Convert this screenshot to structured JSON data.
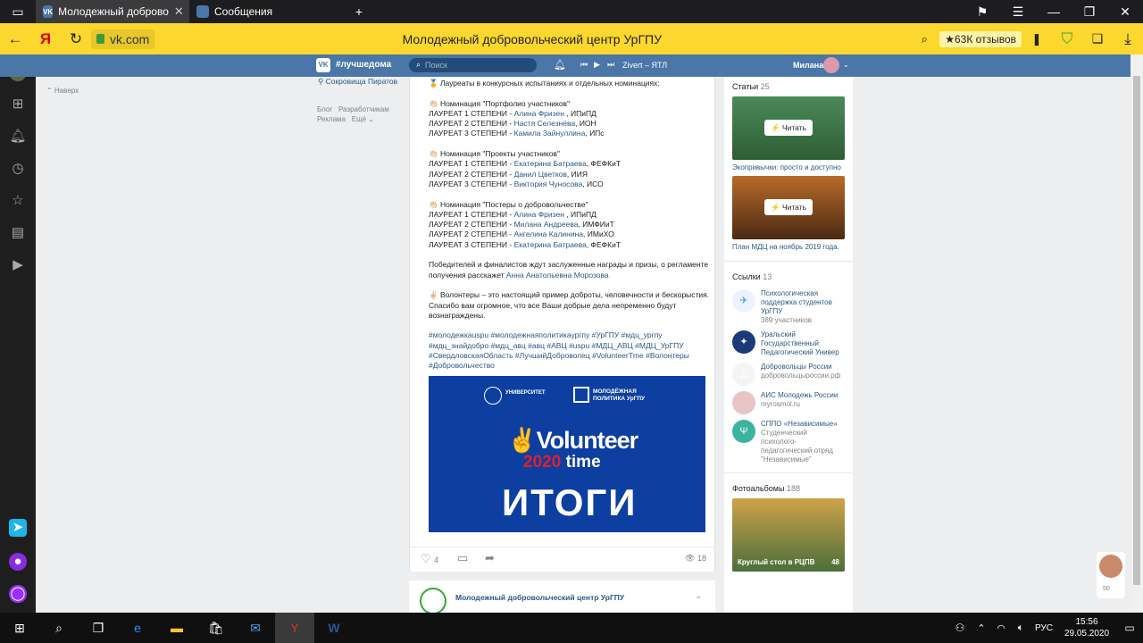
{
  "browser": {
    "tab1": "Молодежный доброво",
    "tab2": "Сообщения",
    "domain": "vk.com",
    "title": "Молодежный добровольческий центр УрГПУ",
    "reviews": "★63К отзывов"
  },
  "vk": {
    "hashtag": "#лучшедома",
    "search_placeholder": "Поиск",
    "track": "Zivert – ЯТЛ",
    "user": "Милана"
  },
  "left": {
    "up": "Наверх",
    "link1": "Сокровища Пиратов",
    "f1": "Блог",
    "f2": "Разработчикам",
    "f3": "Реклама",
    "f4": "Ещё ⌄"
  },
  "post": {
    "intro": "🏅 Лауреаты в конкурсных испытаниях и отдельных номинациях:",
    "n1": "👏🏻 Номинация \"Портфолио участников\"",
    "n1l": [
      [
        "ЛАУРЕАТ 1 СТЕПЕНИ - ",
        "Алина Фризен",
        " , ИПиПД"
      ],
      [
        "ЛАУРЕАТ 2 СТЕПЕНИ - ",
        "Настя Селезнёва",
        ", ИОН"
      ],
      [
        "ЛАУРЕАТ 3 СТЕПЕНИ - ",
        "Камила Зайнуллина",
        ", ИПс"
      ]
    ],
    "n2": "👏🏻 Номинация \"Проекты участников\"",
    "n2l": [
      [
        "ЛАУРЕАТ 1 СТЕПЕНИ - ",
        "Екатерина Батраева",
        ", ФЕФКиТ"
      ],
      [
        "ЛАУРЕАТ 2 СТЕПЕНИ - ",
        "Данил Цветков",
        ", ИИЯ"
      ],
      [
        "ЛАУРЕАТ 3 СТЕПЕНИ - ",
        "Виктория Чуносова",
        ", ИСО"
      ]
    ],
    "n3": "👏🏻 Номинация \"Постеры о добровольчестве\"",
    "n3l": [
      [
        "ЛАУРЕАТ 1 СТЕПЕНИ - ",
        "Алина Фризен",
        " , ИПиПД"
      ],
      [
        "ЛАУРЕАТ 2 СТЕПЕНИ - ",
        "Милана Андреева",
        ", ИМФИиТ"
      ],
      [
        "ЛАУРЕАТ 2 СТЕПЕНИ - ",
        "Ангелина Калинина",
        ", ИМиХО"
      ],
      [
        "ЛАУРЕАТ 3 СТЕПЕНИ - ",
        "Екатерина Батраева",
        ", ФЕФКиТ"
      ]
    ],
    "winners": "Победителей и финалистов ждут заслуженные награды и призы, о регламенте получения расскажет ",
    "winners_link": "Анна Анатольевна Морозова",
    "volunteers": "✌🏻 Волонтеры – это настоящий пример доброты, человечности и бескорыстия. Спасибо вам огромное, что все Ваши добрые дела непременно будут вознаграждены.",
    "tags": "#молодежкаuspu #молодежнаяполитикаургпу #УрГПУ #мдц_ургпу #мдц_знайдобро #мдц_авц #авц #АВЦ #uspu #МДЦ_АВЦ #МДЦ_УрГПУ #СвердловскаяОбласть #ЛучшийДоброволец #VolunteerTme #Волонтеры #Добровольчество",
    "banner_uni": "УНИВЕРСИТЕТ",
    "banner_mp": "МОЛОДЁЖНАЯ ПОЛИТИКА УрГПУ",
    "banner_v": "Volunteer",
    "banner_year": "2020",
    "banner_time": "time",
    "banner_big": "ИТОГИ",
    "likes": "4",
    "views": "18",
    "next_author": "Молодежный добровольческий центр УрГПУ"
  },
  "side": {
    "articles": "Статьи",
    "articles_n": "25",
    "read": "Читать",
    "a1": "Экопривычки: просто и доступно",
    "a2": "План МДЦ на ноябрь 2019 года.",
    "links": "Ссылки",
    "links_n": "13",
    "l": [
      {
        "t": "Психологическая поддержка студентов УрГПУ",
        "s": "389 участников"
      },
      {
        "t": "Уральский Государственный Педагогический Универ",
        "s": ""
      },
      {
        "t": "Добровольцы России",
        "s": "добровольцыроссии.рф"
      },
      {
        "t": "АИС Молодежь России",
        "s": "myrosmol.ru"
      },
      {
        "t": "СППО «Независимые»",
        "s": "Студенческий психолого-педагогический отряд \"Независимые\""
      }
    ],
    "photos": "Фотоальбомы",
    "photos_n": "188",
    "album": "Круглый стол в РЦПВ",
    "album_n": "48"
  },
  "chat_n": "50",
  "taskbar": {
    "lang": "РУС",
    "time": "15:56",
    "date": "29.05.2020"
  }
}
